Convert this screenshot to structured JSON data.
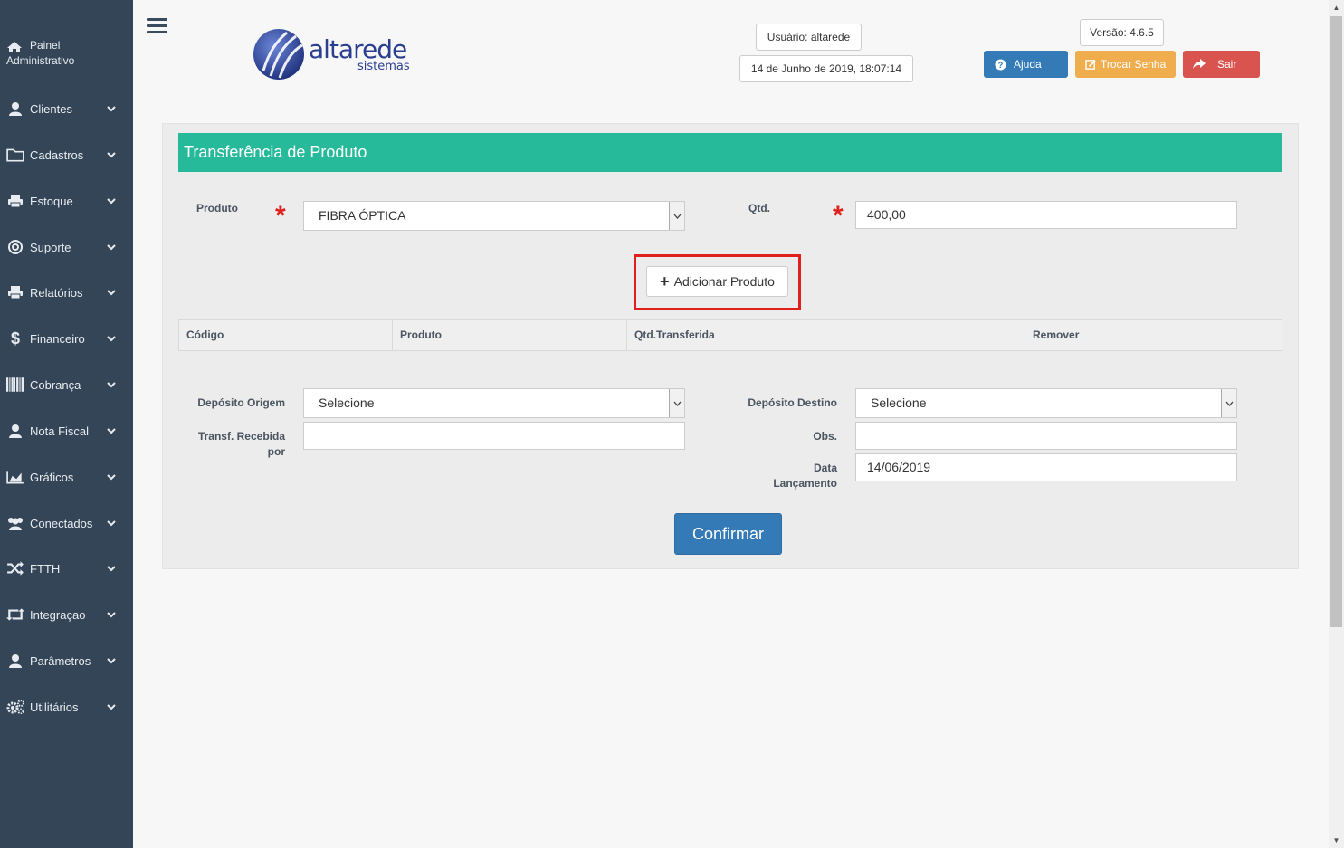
{
  "sidebar": {
    "header": {
      "line1": "Painel",
      "line2": "Administrativo",
      "icon": "home-icon"
    },
    "items": [
      {
        "label": "Clientes",
        "icon": "user-icon"
      },
      {
        "label": "Cadastros",
        "icon": "folder-icon"
      },
      {
        "label": "Estoque",
        "icon": "printer-icon"
      },
      {
        "label": "Suporte",
        "icon": "lifebuoy-icon"
      },
      {
        "label": "Relatórios",
        "icon": "printer-icon"
      },
      {
        "label": "Financeiro",
        "icon": "dollar-icon"
      },
      {
        "label": "Cobrança",
        "icon": "barcode-icon"
      },
      {
        "label": "Nota Fiscal",
        "icon": "user-icon"
      },
      {
        "label": "Gráficos",
        "icon": "area-chart-icon"
      },
      {
        "label": "Conectados",
        "icon": "users-icon"
      },
      {
        "label": "FTTH",
        "icon": "random-icon"
      },
      {
        "label": "Integraçao",
        "icon": "retweet-icon"
      },
      {
        "label": "Parâmetros",
        "icon": "user-icon"
      },
      {
        "label": "Utilitários",
        "icon": "cogs-icon"
      }
    ]
  },
  "header": {
    "logo_word": "altarede",
    "logo_sub": "sistemas",
    "user": "Usuário: altarede",
    "datetime": "14 de Junho de 2019, 18:07:14",
    "version": "Versão: 4.6.5",
    "help_label": "Ajuda",
    "change_password_label": "Trocar Senha",
    "logout_label": "Sair",
    "colors": {
      "help": "#337ab7",
      "change_password": "#f0ad4e",
      "logout": "#d9534f"
    }
  },
  "form": {
    "title": "Transferência de Produto",
    "product_label": "Produto",
    "product_value": "FIBRA ÓPTICA",
    "qty_label": "Qtd.",
    "qty_value": "400,00",
    "add_button_label": "Adicionar Produto",
    "table_headers": [
      "Código",
      "Produto",
      "Qtd.Transferida",
      "Remover"
    ],
    "origin_label": "Depósito Origem",
    "origin_value": "Selecione",
    "dest_label": "Depósito Destino",
    "dest_value": "Selecione",
    "received_by_label_1": "Transf. Recebida",
    "received_by_label_2": "por",
    "received_by_value": "",
    "obs_label": "Obs.",
    "obs_value": "",
    "date_label_1": "Data",
    "date_label_2": "Lançamento",
    "date_value": "14/06/2019",
    "confirm_label": "Confirmar",
    "required_mark": "*",
    "accent": "#26b99a"
  }
}
